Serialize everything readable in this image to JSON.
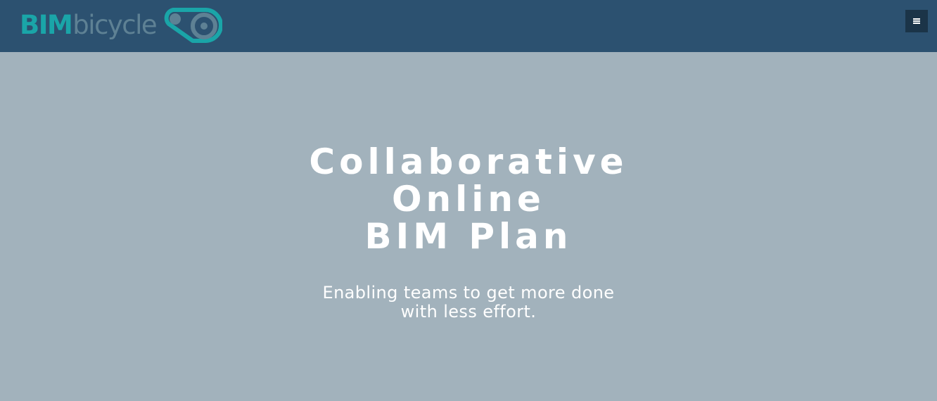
{
  "brand": {
    "name_part_1": "BIM",
    "name_part_2": "bicycle",
    "logo_icon": "bicycle-chain-icon",
    "colors": {
      "primary": "#1aa5a8",
      "secondary": "#5e8194"
    }
  },
  "navbar": {
    "background": "#2c5170",
    "menu_icon": "hamburger-menu-icon"
  },
  "hero": {
    "background": "#a2b2bc",
    "title_lines": [
      "Collaborative",
      "Online",
      "BIM Plan"
    ],
    "subtitle_lines": [
      "Enabling teams to get more done",
      "with less effort."
    ]
  }
}
